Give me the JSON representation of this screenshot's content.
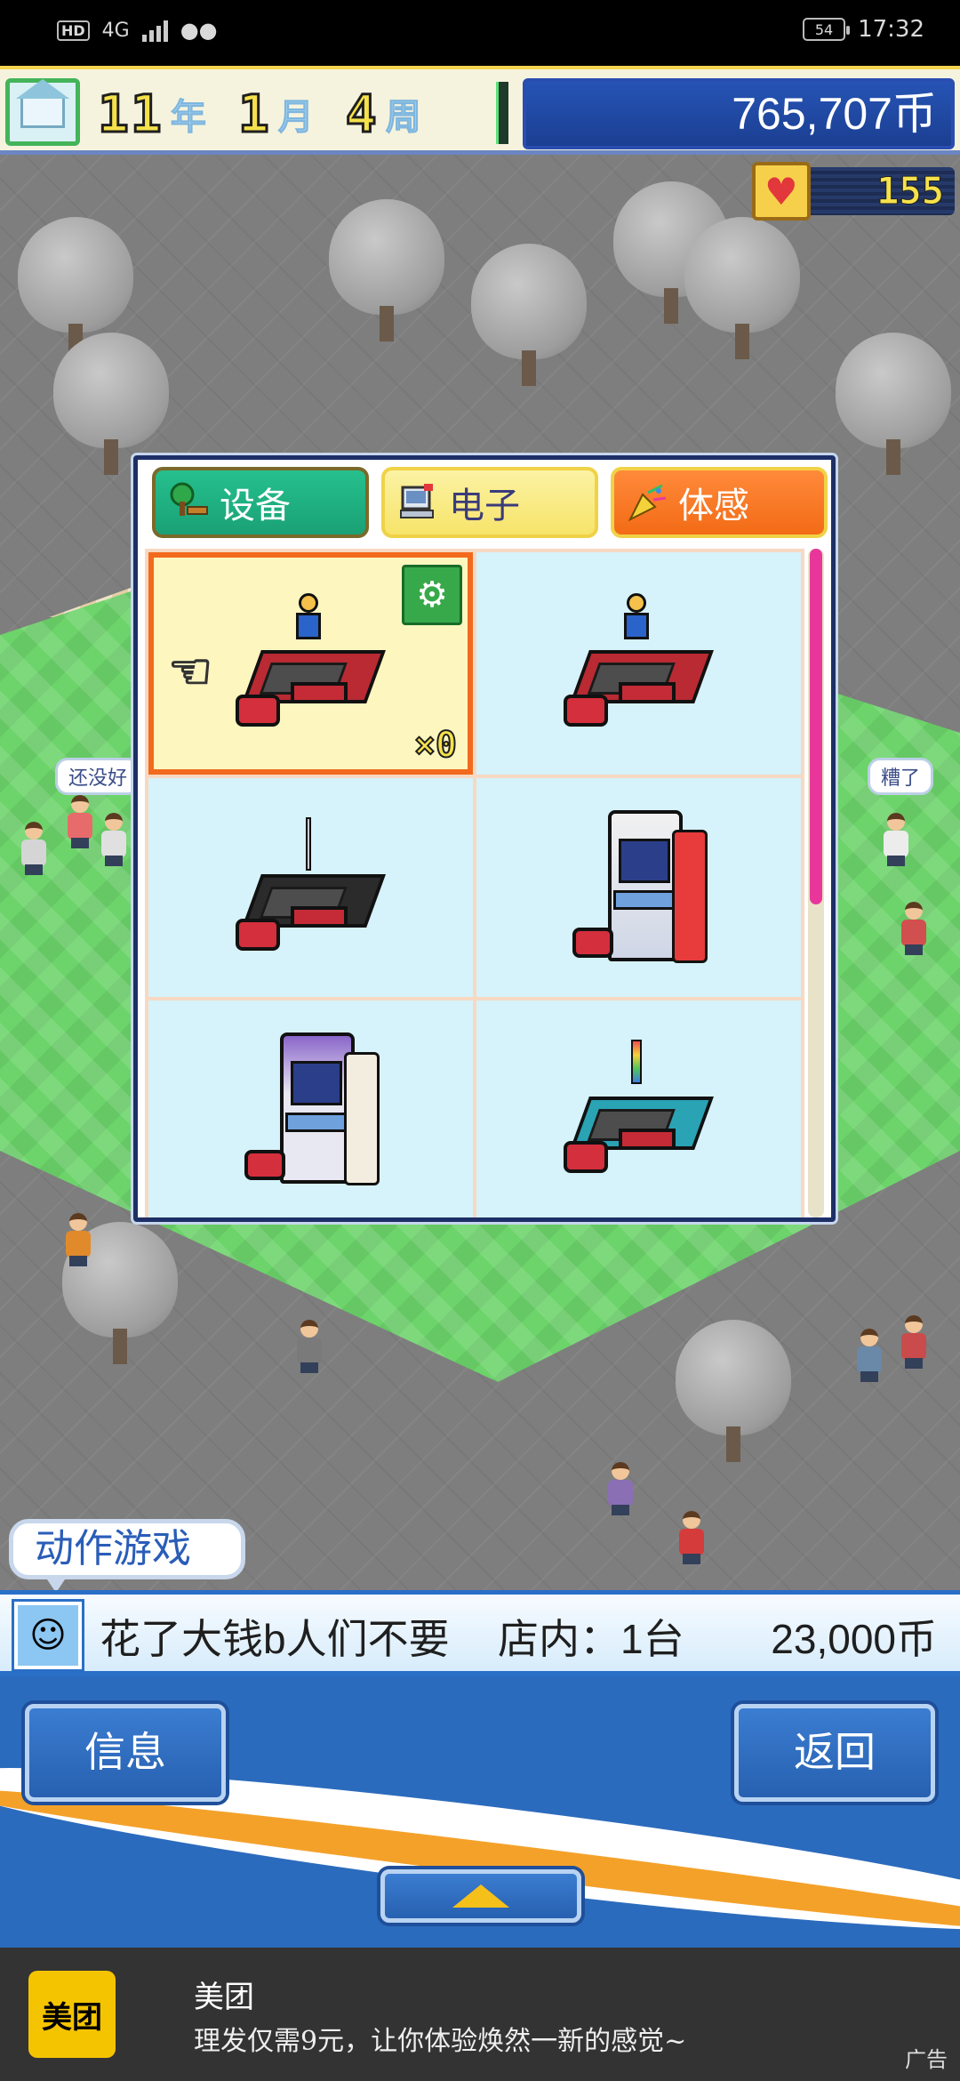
{
  "status_bar": {
    "network": "HD",
    "signal": "4G",
    "battery": "54",
    "time": "17:32"
  },
  "hud": {
    "year": "11",
    "year_unit": "年",
    "month": "1",
    "month_unit": "月",
    "week": "4",
    "week_unit": "周",
    "money": "765,707币",
    "hearts": "155"
  },
  "world": {
    "bubble_left": "还没好",
    "bubble_right": "糟了"
  },
  "panel": {
    "tabs": [
      {
        "label": "设备",
        "icon": "bench-tree-icon"
      },
      {
        "label": "电子",
        "icon": "computer-icon"
      },
      {
        "label": "体感",
        "icon": "party-popper-icon"
      }
    ],
    "selected_count": "×0",
    "items": [
      {
        "icon": "arcade-table-cabinet-icon",
        "selected": true
      },
      {
        "icon": "arcade-table-cabinet-icon",
        "selected": false
      },
      {
        "icon": "arcade-table-sword-icon",
        "selected": false
      },
      {
        "icon": "arcade-upright-cabinet-icon",
        "selected": false
      },
      {
        "icon": "arcade-upright-purple-icon",
        "selected": false
      },
      {
        "icon": "arcade-table-teal-icon",
        "selected": false
      }
    ]
  },
  "info": {
    "category_tag": "动作游戏",
    "message": "花了大钱b人们不要",
    "count": "店内：1台",
    "price": "23,000币"
  },
  "buttons": {
    "info": "信息",
    "back": "返回"
  },
  "ad": {
    "logo": "美团",
    "title": "美团",
    "text": "理发仅需9元，让你体验焕然一新的感觉~",
    "mark": "广告"
  }
}
